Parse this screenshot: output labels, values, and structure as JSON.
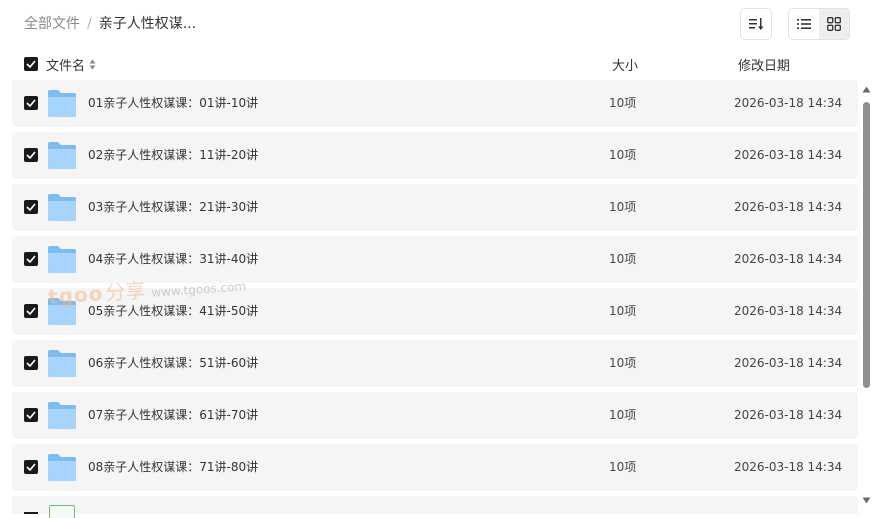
{
  "breadcrumb": {
    "root": "全部文件",
    "separator": "/",
    "current": "亲子人性权谋..."
  },
  "toolbar": {
    "sort_icon": "sort-icon",
    "list_view_icon": "list-view-icon",
    "grid_view_icon": "grid-view-icon"
  },
  "columns": {
    "name": "文件名",
    "size": "大小",
    "date": "修改日期"
  },
  "rows": [
    {
      "name": "01亲子人性权谋课：01讲-10讲",
      "size": "10项",
      "date": "2026-03-18 14:34"
    },
    {
      "name": "02亲子人性权谋课：11讲-20讲",
      "size": "10项",
      "date": "2026-03-18 14:34"
    },
    {
      "name": "03亲子人性权谋课：21讲-30讲",
      "size": "10项",
      "date": "2026-03-18 14:34"
    },
    {
      "name": "04亲子人性权谋课：31讲-40讲",
      "size": "10项",
      "date": "2026-03-18 14:34"
    },
    {
      "name": "05亲子人性权谋课：41讲-50讲",
      "size": "10项",
      "date": "2026-03-18 14:34"
    },
    {
      "name": "06亲子人性权谋课：51讲-60讲",
      "size": "10项",
      "date": "2026-03-18 14:34"
    },
    {
      "name": "07亲子人性权谋课：61讲-70讲",
      "size": "10项",
      "date": "2026-03-18 14:34"
    },
    {
      "name": "08亲子人性权谋课：71讲-80讲",
      "size": "10项",
      "date": "2026-03-18 14:34"
    }
  ],
  "watermark": {
    "logo": "tgoo",
    "share": "分享",
    "url": "www.tgoos.com"
  },
  "colors": {
    "row_bg": "#f5f5f5",
    "folder_blue": "#8cc8f5",
    "checkbox": "#1a1a1a",
    "scroll_thumb": "#8f8f8f"
  }
}
